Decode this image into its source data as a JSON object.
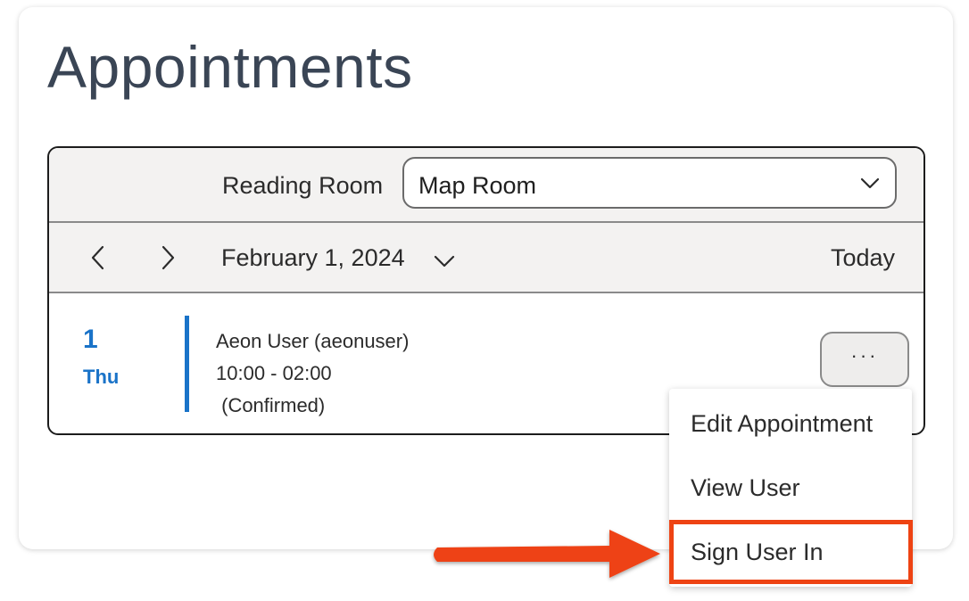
{
  "page": {
    "title": "Appointments"
  },
  "filters": {
    "reading_room_label": "Reading Room",
    "reading_room_value": "Map Room"
  },
  "date_nav": {
    "date": "February 1, 2024",
    "today_label": "Today"
  },
  "appointment": {
    "day_number": "1",
    "day_name": "Thu",
    "user": "Aeon User (aeonuser)",
    "time": "10:00 - 02:00",
    "status": " (Confirmed)",
    "more_label": "···"
  },
  "menu": {
    "items": [
      {
        "label": "Edit Appointment"
      },
      {
        "label": "View User"
      },
      {
        "label": "Sign User In"
      }
    ]
  },
  "colors": {
    "accent": "#1a73c8",
    "highlight": "#ee4313",
    "title": "#3a4555"
  }
}
